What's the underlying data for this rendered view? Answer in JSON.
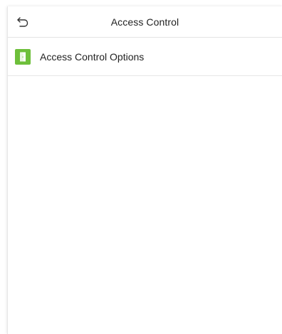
{
  "header": {
    "title": "Access Control",
    "back_icon": "back-arrow-icon"
  },
  "menu": {
    "items": [
      {
        "label": "Access Control Options",
        "icon": "door-icon",
        "icon_color": "#6dbf3a"
      }
    ]
  },
  "colors": {
    "accent_green": "#6dbf3a",
    "divider": "#e3e3e3"
  }
}
